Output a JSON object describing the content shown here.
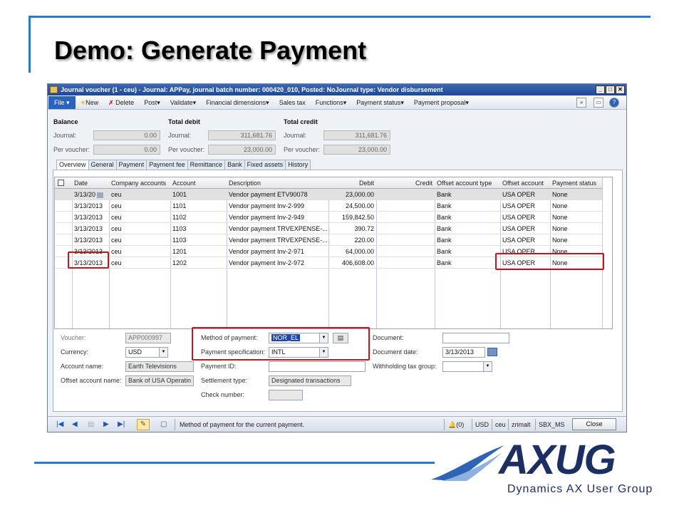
{
  "slide": {
    "title": "Demo: Generate Payment"
  },
  "logo": {
    "wordmark": "AXUG",
    "tagline": "Dynamics AX User Group"
  },
  "window": {
    "title": "Journal voucher (1 - ceu) - Journal: APPay, journal batch number: 000420_010, Posted: NoJournal type: Vendor disbursement",
    "controls": [
      "_",
      "□",
      "✕"
    ]
  },
  "menu": {
    "file": "File",
    "items": [
      "New",
      "Delete",
      "Post",
      "Validate",
      "Financial dimensions",
      "Sales tax",
      "Functions",
      "Payment status",
      "Payment proposal"
    ]
  },
  "header": {
    "balance": "Balance",
    "total_debit": "Total debit",
    "total_credit": "Total credit",
    "journal": "Journal:",
    "per_voucher": "Per voucher:",
    "bal_journal": "0.00",
    "bal_voucher": "0.00",
    "debit_journal": "311,681.76",
    "debit_voucher": "23,000.00",
    "credit_journal": "311,681.76",
    "credit_voucher": "23,000.00"
  },
  "tabs": [
    "Overview",
    "General",
    "Payment",
    "Payment fee",
    "Remittance",
    "Bank",
    "Fixed assets",
    "History"
  ],
  "grid": {
    "columns": [
      "Date",
      "Company accounts",
      "Account",
      "Description",
      "Debit",
      "Credit",
      "Offset account type",
      "Offset account",
      "Payment status"
    ],
    "rows": [
      [
        "3/13/20",
        "ceu",
        "1001",
        "Vendor payment ETV90078",
        "23,000.00",
        "",
        "Bank",
        "USA OPER",
        "None"
      ],
      [
        "3/13/2013",
        "ceu",
        "1101",
        "Vendor payment Inv-2-999",
        "24,500.00",
        "",
        "Bank",
        "USA OPER",
        "None"
      ],
      [
        "3/13/2013",
        "ceu",
        "1102",
        "Vendor payment Inv-2-949",
        "159,842.50",
        "",
        "Bank",
        "USA OPER",
        "None"
      ],
      [
        "3/13/2013",
        "ceu",
        "1103",
        "Vendor payment TRVEXPENSE-...",
        "390.72",
        "",
        "Bank",
        "USA OPER",
        "None"
      ],
      [
        "3/13/2013",
        "ceu",
        "1103",
        "Vendor payment TRVEXPENSE-...",
        "220.00",
        "",
        "Bank",
        "USA OPER",
        "None"
      ],
      [
        "3/13/2013",
        "ceu",
        "1201",
        "Vendor payment Inv-2-971",
        "64,000.00",
        "",
        "Bank",
        "USA OPER",
        "None"
      ],
      [
        "3/13/2013",
        "ceu",
        "1202",
        "Vendor payment Inv-2-972",
        "406,608.00",
        "",
        "Bank",
        "USA OPER",
        "None"
      ]
    ]
  },
  "form": {
    "voucher_label": "Voucher:",
    "voucher": "APP000997",
    "currency_label": "Currency:",
    "currency": "USD",
    "account_name_label": "Account name:",
    "account_name": "Earth Televisions",
    "offset_name_label": "Offset account name:",
    "offset_name": "Bank of USA Operatin",
    "method_label": "Method of payment:",
    "method": "NOR_EL",
    "spec_label": "Payment specification:",
    "spec": "INTL",
    "payment_id_label": "Payment ID:",
    "payment_id": "",
    "settlement_label": "Settlement type:",
    "settlement": "Designated transactions",
    "check_label": "Check number:",
    "check": "",
    "document_label": "Document:",
    "document": "",
    "doc_date_label": "Document date:",
    "doc_date": "3/13/2013",
    "wht_label": "Withholding tax group:",
    "wht": ""
  },
  "status": {
    "help": "Method of payment for the current payment.",
    "alerts": "(0)",
    "currency": "USD",
    "company": "ceu",
    "user": "zrimalt",
    "partition": "SBX_MS",
    "close": "Close"
  },
  "colors": {
    "accent": "#2c79c5",
    "highlight": "#c4161c",
    "titlebar": "#1e4a94"
  }
}
